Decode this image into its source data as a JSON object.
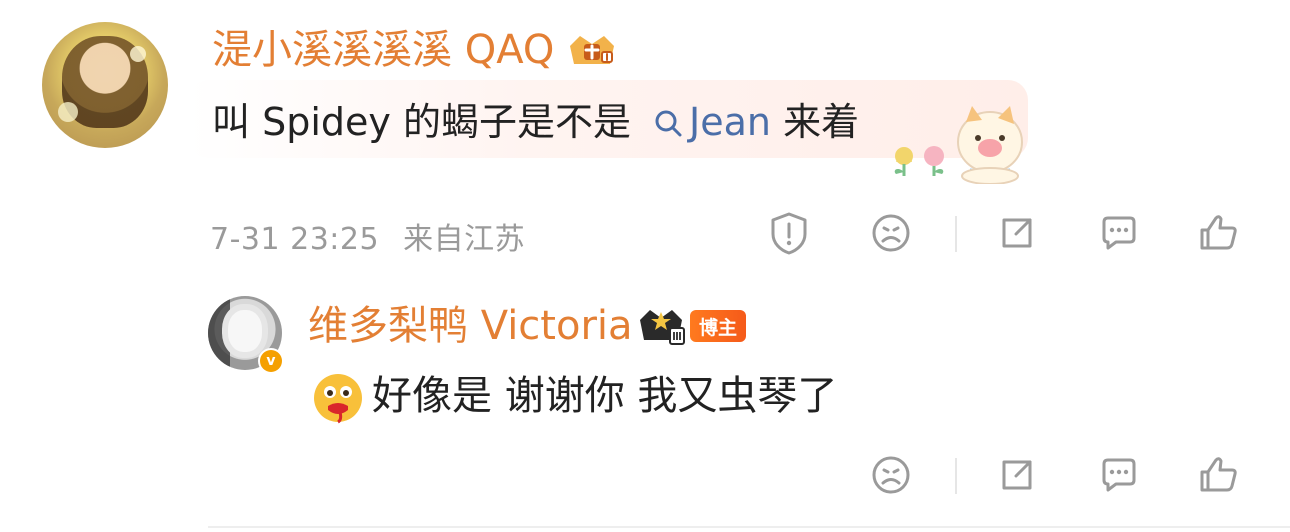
{
  "comment1": {
    "username": "湜小溪溪溪溪 QAQ",
    "text_before": "叫 Spidey 的蝎子是不是",
    "link": "Jean",
    "text_after": "来着",
    "timestamp": "7-31 23:25",
    "location": "来自江苏"
  },
  "reply1": {
    "username": "维多梨鸭 Victoria",
    "badge": "博主",
    "text": "好像是 谢谢你 我又虫琴了"
  },
  "icons": {
    "report": "report-icon",
    "dislike": "dislike-face-icon",
    "share": "share-icon",
    "comment": "comment-icon",
    "like": "like-icon"
  },
  "colors": {
    "username": "#e37f34",
    "link": "#4b6ea8",
    "meta": "#9a9a9a",
    "icon": "#9a9a9a",
    "badge_bg": "#f55a1a"
  }
}
